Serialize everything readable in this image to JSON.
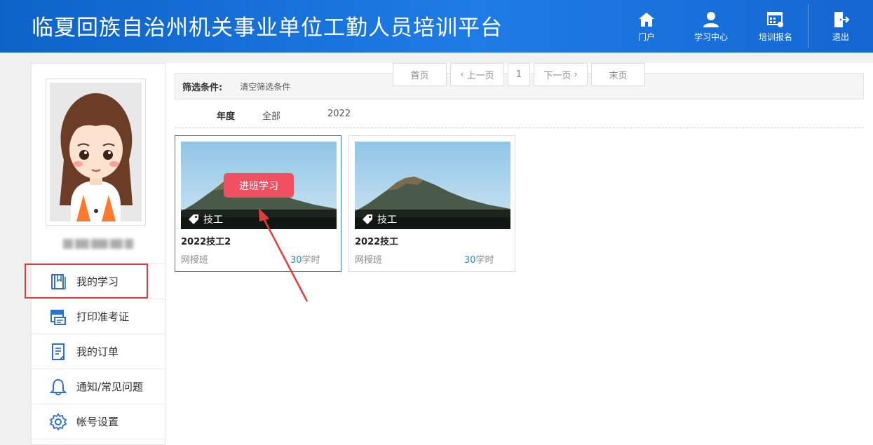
{
  "header": {
    "title": "临夏回族自治州机关事业单位工勤人员培训平台",
    "nav": [
      {
        "label": "门户",
        "icon": "home-icon"
      },
      {
        "label": "学习中心",
        "icon": "user-icon"
      },
      {
        "label": "培训报名",
        "icon": "register-icon"
      },
      {
        "label": "退出",
        "icon": "logout-icon"
      }
    ]
  },
  "sidebar": {
    "menu": [
      {
        "label": "我的学习",
        "icon": "book-icon"
      },
      {
        "label": "打印准考证",
        "icon": "print-icon"
      },
      {
        "label": "我的订单",
        "icon": "order-icon"
      },
      {
        "label": "通知/常见问题",
        "icon": "bell-icon"
      },
      {
        "label": "帐号设置",
        "icon": "gear-icon"
      }
    ]
  },
  "filter": {
    "label": "筛选条件:",
    "clear": "清空筛选条件",
    "year_label": "年度",
    "year_options": [
      "全部",
      "2022"
    ]
  },
  "courses": [
    {
      "tag": "技工",
      "title": "2022技工2",
      "type": "网授班",
      "hours": "30",
      "hours_unit": "学时",
      "button": "进班学习"
    },
    {
      "tag": "技工",
      "title": "2022技工",
      "type": "网授班",
      "hours": "30",
      "hours_unit": "学时"
    }
  ],
  "pager": {
    "first": "首页",
    "prev": "上一页",
    "current": "1",
    "next": "下一页",
    "last": "末页"
  },
  "colors": {
    "header_blue": "#1a70d8",
    "accent_red": "#f0505f",
    "link_blue": "#2e86c8",
    "highlight_red": "#e43c3c"
  }
}
